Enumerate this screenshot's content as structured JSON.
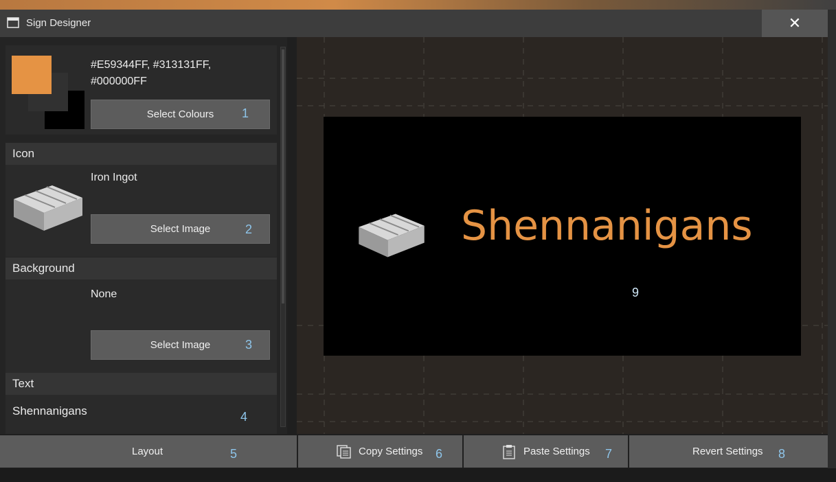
{
  "window": {
    "title": "Sign Designer",
    "close_label": "✕"
  },
  "colours": {
    "value": "#E59344FF, #313131FF, #000000FF",
    "swatches": [
      "#E59344",
      "#313131",
      "#000000"
    ],
    "select_label": "Select Colours",
    "marker": "1"
  },
  "icon": {
    "header": "Icon",
    "value": "Iron Ingot",
    "select_label": "Select Image",
    "marker": "2"
  },
  "background": {
    "header": "Background",
    "value": "None",
    "select_label": "Select Image",
    "marker": "3"
  },
  "text": {
    "header": "Text",
    "value": "Shennanigans",
    "marker": "4"
  },
  "preview": {
    "sign_text": "Shennanigans",
    "text_color": "#E59344",
    "bg_color": "#000000",
    "marker": "9"
  },
  "bottom": {
    "layout_label": "Layout",
    "layout_marker": "5",
    "copy_label": "Copy Settings",
    "copy_marker": "6",
    "paste_label": "Paste Settings",
    "paste_marker": "7",
    "revert_label": "Revert Settings",
    "revert_marker": "8"
  }
}
